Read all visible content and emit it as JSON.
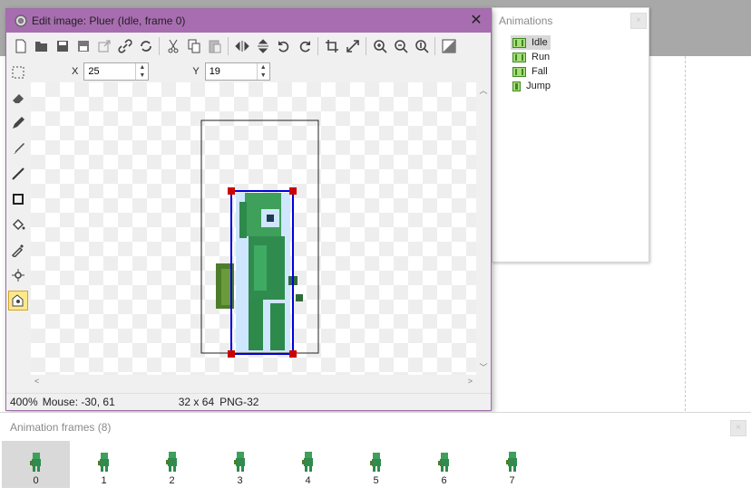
{
  "animations_panel": {
    "title": "Animations",
    "close_glyph": "×",
    "items": [
      {
        "label": "Idle",
        "selected": true
      },
      {
        "label": "Run",
        "selected": false
      },
      {
        "label": "Fall",
        "selected": false
      },
      {
        "label": "Jump",
        "selected": false
      }
    ]
  },
  "editor": {
    "title": "Edit image: Pluer (Idle, frame 0)",
    "close_glyph": "✕",
    "toolbar_icons": [
      "new-icon",
      "open-icon",
      "save-icon",
      "save-as-icon",
      "export-icon",
      "link-icon",
      "refresh-icon",
      "cut-icon",
      "copy-icon",
      "paste-icon",
      "flip-horizontal-icon",
      "flip-vertical-icon",
      "rotate-left-icon",
      "rotate-right-icon",
      "crop-icon",
      "resize-icon",
      "zoom-in-icon",
      "zoom-out-icon",
      "zoom-reset-icon",
      "transparency-icon"
    ],
    "side_tools": [
      "select-icon",
      "eraser-icon",
      "pencil-icon",
      "brush-icon",
      "line-icon",
      "rectangle-icon",
      "fill-icon",
      "eyedropper-icon",
      "origin-icon",
      "hotspot-icon"
    ],
    "x_label": "X",
    "x_value": "25",
    "y_label": "Y",
    "y_value": "19",
    "status": {
      "zoom": "400%",
      "mouse": "Mouse: -30, 61",
      "size": "32 x 64",
      "format": "PNG-32"
    },
    "colors": {
      "titlebar": "#a86db0",
      "selection": "#0000dd",
      "handle": "#cc0000"
    }
  },
  "frames_panel": {
    "title": "Animation frames (8)",
    "close_glyph": "×",
    "frames": [
      {
        "label": "0",
        "selected": true
      },
      {
        "label": "1",
        "selected": false
      },
      {
        "label": "2",
        "selected": false
      },
      {
        "label": "3",
        "selected": false
      },
      {
        "label": "4",
        "selected": false
      },
      {
        "label": "5",
        "selected": false
      },
      {
        "label": "6",
        "selected": false
      },
      {
        "label": "7",
        "selected": false
      }
    ]
  }
}
